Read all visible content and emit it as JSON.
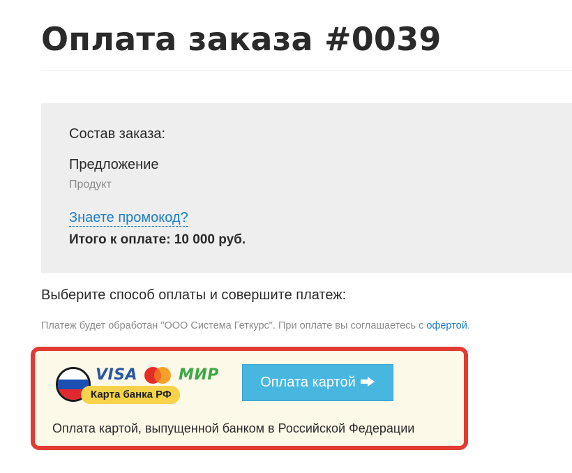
{
  "page": {
    "title": "Оплата заказа #0039"
  },
  "order": {
    "heading": "Состав заказа:",
    "item_name": "Предложение",
    "item_type": "Продукт",
    "promo_link": "Знаете промокод?",
    "total": "Итого к оплате: 10 000 руб."
  },
  "payment": {
    "choose_text": "Выберите способ оплаты и совершите платеж:",
    "processor_text": "Платеж будет обработан \"ООО Система Геткурс\". При оплате вы соглашаетесь с ",
    "offer_link": "офертой",
    "processor_suffix": ".",
    "method": {
      "visa_label": "VISA",
      "mir_label": "МИР",
      "badge": "Карта банка РФ",
      "button_label": "Оплата картой",
      "description": "Оплата картой, выпущенной банком в Российской Федерации",
      "icons": [
        "russia-flag-icon",
        "visa-icon",
        "mastercard-icon",
        "mir-icon",
        "arrow-right-icon"
      ]
    }
  },
  "colors": {
    "accent_link": "#1d7ec2",
    "button": "#48b7e0",
    "highlight_border": "#e23b31",
    "card_background": "#fdf9e8",
    "order_background": "#eeeeee",
    "badge": "#f7d34b"
  }
}
